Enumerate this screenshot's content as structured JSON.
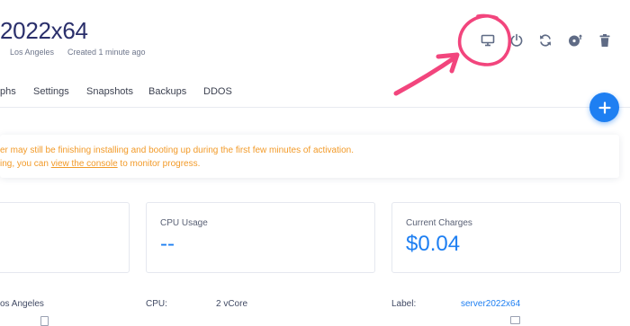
{
  "server": {
    "title": "2022x64",
    "location": "Los Angeles",
    "created": "Created 1 minute ago"
  },
  "actions": [
    {
      "name": "view-console",
      "icon": "monitor-icon"
    },
    {
      "name": "power",
      "icon": "power-icon"
    },
    {
      "name": "restart",
      "icon": "refresh-icon"
    },
    {
      "name": "reinstall",
      "icon": "disc-icon"
    },
    {
      "name": "destroy",
      "icon": "trash-icon"
    }
  ],
  "tabs": [
    "phs",
    "Settings",
    "Snapshots",
    "Backups",
    "DDOS"
  ],
  "fab_icon": "plus-icon",
  "alert": {
    "line1": "er may still be finishing installing and booting up during the first few minutes of activation.",
    "line2_prefix": "ing, you can ",
    "line2_link": "view the console",
    "line2_suffix": " to monitor progress."
  },
  "cards": {
    "cpu_usage": {
      "label": "CPU Usage",
      "value": "--"
    },
    "current_charges": {
      "label": "Current Charges",
      "value": "$0.04"
    }
  },
  "info": {
    "location": "os Angeles",
    "cpu_label": "CPU:",
    "cpu_value": "2 vCore",
    "label_label": "Label:",
    "label_value": "server2022x64"
  },
  "colors": {
    "accent": "#1e7ff2",
    "title": "#2a2f6b",
    "warning": "#f29a28",
    "annotation": "#f2457d"
  }
}
